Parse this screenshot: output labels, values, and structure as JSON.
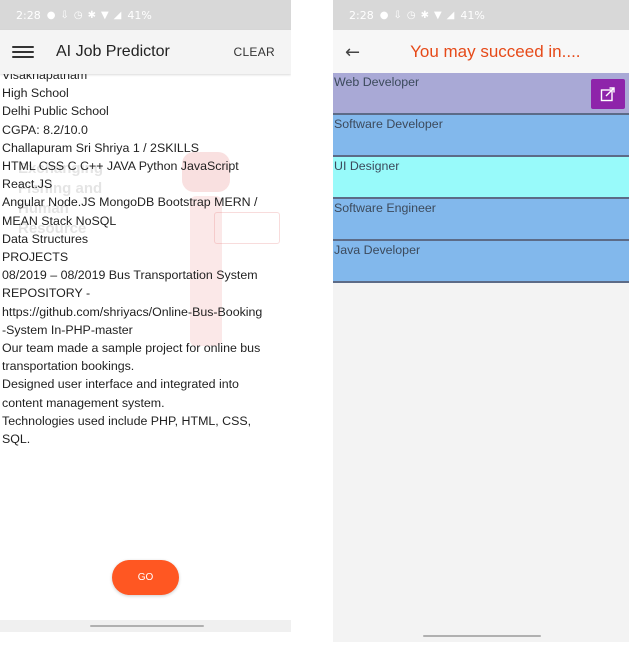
{
  "left_screen": {
    "status_bar": {
      "time": "2:28",
      "battery": "41%"
    },
    "app_title": "AI Job Predictor",
    "clear_label": "CLEAR",
    "resume_lines": [
      "Visakhapatnam",
      "High School",
      "Delhi Public School",
      "CGPA: 8.2/10.0",
      "Challapuram Sri Shriya 1 / 2SKILLS",
      "HTML CSS C C++ JAVA Python JavaScript",
      "React.JS",
      "Angular Node.JS MongoDB Bootstrap MERN /",
      "MEAN Stack NoSQL",
      "Data Structures",
      "PROJECTS",
      "08/2019 – 08/2019 Bus Transportation System",
      "REPOSITORY -",
      "https://github.com/shriyacs/Online-Bus-Booking",
      "-System In-PHP-master",
      "Our team made a sample project for online bus",
      "transportation bookings.",
      "Designed user interface and integrated into",
      "content management system.",
      "Technologies used include PHP, HTML, CSS,",
      "SQL."
    ],
    "go_label": "GO"
  },
  "right_screen": {
    "status_bar": {
      "time": "2:28",
      "battery": "41%"
    },
    "title": "You may succeed in....",
    "jobs": [
      {
        "label": "Web Developer",
        "color": "#a9a9d6"
      },
      {
        "label": "Software Developer",
        "color": "#82b8ec"
      },
      {
        "label": "UI Designer",
        "color": "#98fafa"
      },
      {
        "label": "Software Engineer",
        "color": "#82b8ec"
      },
      {
        "label": "Java Developer",
        "color": "#82b8ec"
      }
    ]
  },
  "colors": {
    "go_button": "#ff5722",
    "result_title": "#e64a19",
    "share_button": "#8e24aa"
  }
}
